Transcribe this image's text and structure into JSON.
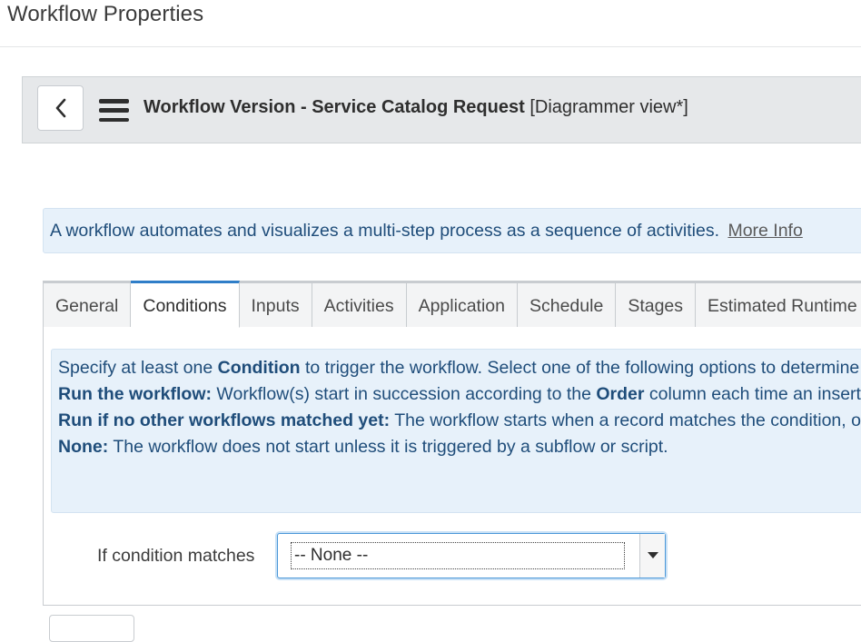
{
  "page": {
    "title": "Workflow Properties"
  },
  "form_header": {
    "title_bold": "Workflow Version - Service Catalog Request",
    "title_suffix": "[Diagrammer view*]"
  },
  "info_banner": {
    "text": "A workflow automates and visualizes a multi-step process as a sequence of activities.",
    "link": "More Info"
  },
  "tabs": [
    {
      "label": "General"
    },
    {
      "label": "Conditions",
      "active": true
    },
    {
      "label": "Inputs"
    },
    {
      "label": "Activities"
    },
    {
      "label": "Application"
    },
    {
      "label": "Schedule"
    },
    {
      "label": "Stages"
    },
    {
      "label": "Estimated Runtime"
    }
  ],
  "conditions": {
    "line1_pre": "Specify at least one",
    "line1_bold": "Condition",
    "line1_post": "to trigger the workflow. Select one of the following options to determine w",
    "line2_bold": "Run the workflow:",
    "line2_mid": "Workflow(s) start in succession according to the",
    "line2_bold2": "Order",
    "line2_post": "column each time an inserted",
    "line3_bold": "Run if no other workflows matched yet:",
    "line3_post": "The workflow starts when a record matches the condition, only",
    "line4_bold": "None:",
    "line4_post": "The workflow does not start unless it is triggered by a subflow or script.",
    "field_label": "If condition matches",
    "select_value": "-- None --"
  },
  "colors": {
    "accent": "#2f7ec8",
    "banner_bg": "#e7f1fa",
    "banner_text": "#1f4d7a"
  },
  "icons": {
    "back": "chevron-left-icon",
    "menu": "hamburger-menu-icon",
    "dropdown": "caret-down-icon"
  }
}
